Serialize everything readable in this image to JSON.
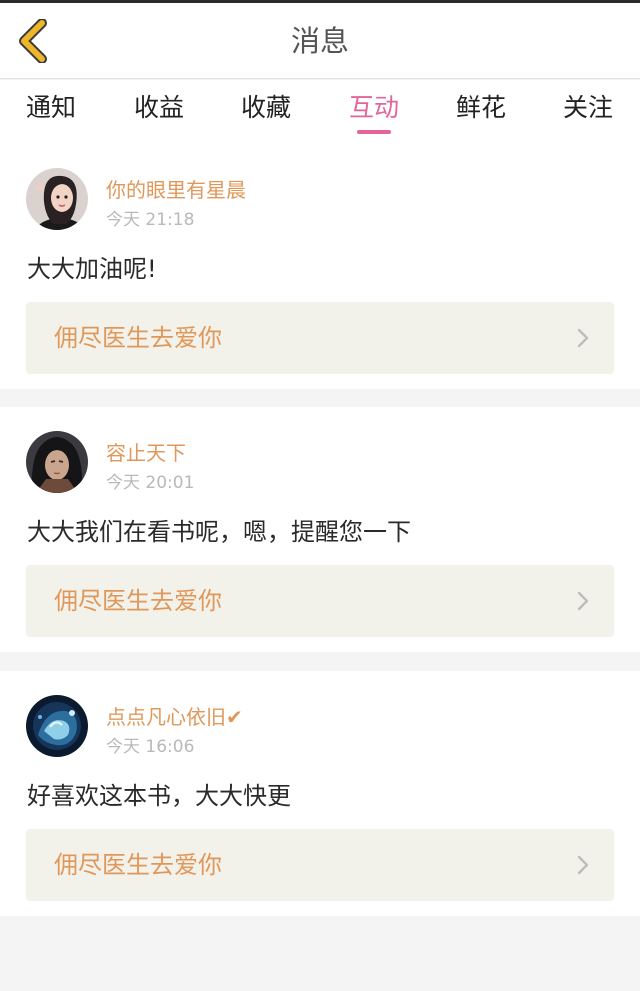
{
  "header": {
    "title": "消息"
  },
  "tabs": [
    {
      "label": "通知",
      "active": false
    },
    {
      "label": "收益",
      "active": false
    },
    {
      "label": "收藏",
      "active": false
    },
    {
      "label": "互动",
      "active": true
    },
    {
      "label": "鲜花",
      "active": false
    },
    {
      "label": "关注",
      "active": false
    }
  ],
  "messages": [
    {
      "username": "你的眼里有星晨",
      "time": "今天 21:18",
      "text": "大大加油呢!",
      "book": "佣尽医生去爱你",
      "verified": false
    },
    {
      "username": "容止天下",
      "time": "今天 20:01",
      "text": "大大我们在看书呢，嗯，提醒您一下",
      "book": "佣尽医生去爱你",
      "verified": false
    },
    {
      "username": "点点凡心依旧",
      "verified_mark": "✔",
      "time": "今天 16:06",
      "text": "好喜欢这本书，大大快更",
      "book": "佣尽医生去爱你",
      "verified": true
    }
  ],
  "colors": {
    "accent": "#e4649c",
    "username": "#e0985a",
    "back_icon": "#f0b62a",
    "book_bg": "#f3f2ea"
  },
  "icons": {
    "back": "chevron-left-icon",
    "row": "chevron-right-icon",
    "verified": "checkmark-icon"
  }
}
